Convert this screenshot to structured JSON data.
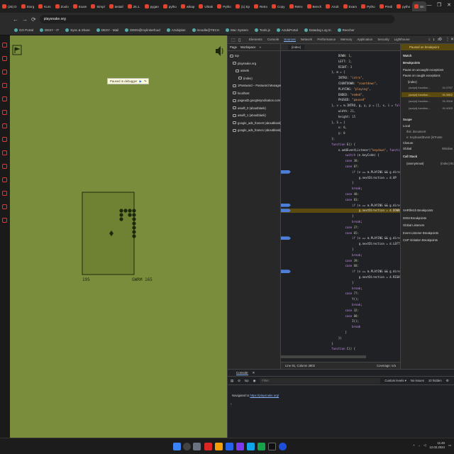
{
  "tabs": [
    {
      "label": "(26) D"
    },
    {
      "label": "Storg"
    },
    {
      "label": "Kurs"
    },
    {
      "label": "Zoolo"
    },
    {
      "label": "Exam"
    },
    {
      "label": "Simpl"
    },
    {
      "label": "testatl"
    },
    {
      "label": "26.1."
    },
    {
      "label": "pygan"
    },
    {
      "label": "pytho"
    },
    {
      "label": "wikap"
    },
    {
      "label": "Ultrak"
    },
    {
      "label": "Pytho"
    },
    {
      "label": "(1) Ep"
    },
    {
      "label": "Retro"
    },
    {
      "label": "Copy"
    },
    {
      "label": "Retro"
    },
    {
      "label": "Bench"
    },
    {
      "label": "Azub"
    },
    {
      "label": "Exam"
    },
    {
      "label": "Pytho"
    },
    {
      "label": "Predi"
    },
    {
      "label": "pytho"
    },
    {
      "label": "Sn",
      "active": true
    }
  ],
  "window_controls": [
    "—",
    "❐",
    "✕"
  ],
  "address": {
    "url": "playsnake.org",
    "nav": [
      "←",
      "→",
      "⟳"
    ]
  },
  "bookmarks": [
    "GO Portal",
    "DESY - IT",
    "Sync & Share",
    "DESY - Mail",
    "DEEN@mylinkerfood",
    "Azubiplan",
    "moodle@TECH",
    "Mac System",
    "Tools.js",
    "AzubiPortal",
    "Datadog Log In",
    "Reecher"
  ],
  "game": {
    "paused_banner": "Paused in debugger",
    "score_left": "195",
    "score_right": "GWRM 165",
    "colors": {
      "background": "#7a8d3c",
      "board": "#6f8133",
      "ink": "#1c2a0b"
    }
  },
  "devtools": {
    "tabs": [
      "Elements",
      "Console",
      "Sources",
      "Network",
      "Performance",
      "Memory",
      "Application",
      "Security",
      "Lighthouse"
    ],
    "active_tab": "Sources",
    "badges": {
      "errors": "1",
      "warnings": "1",
      "issues": "2"
    },
    "nav_tabs": [
      "Page",
      "Workspace",
      "»"
    ],
    "tree": [
      {
        "label": "top",
        "depth": 0
      },
      {
        "label": "playsnake.org",
        "depth": 1
      },
      {
        "label": "assets",
        "depth": 2
      },
      {
        "label": "(index)",
        "depth": 3
      },
      {
        "label": "1Password – Password Manager",
        "depth": 1
      },
      {
        "label": "localhost",
        "depth": 1
      },
      {
        "label": "pagead2.googlesyndication.com",
        "depth": 1
      },
      {
        "label": "aswift_0 (aboutblank)",
        "depth": 1
      },
      {
        "label": "aswift_1 (aboutblank)",
        "depth": 1
      },
      {
        "label": "google_ads_frame0 (aboutblank)",
        "depth": 1
      },
      {
        "label": "google_ads_frame1 (aboutblank)",
        "depth": 1
      }
    ],
    "open_file": "(index)",
    "code_lines": [
      {
        "t": "            DOWN: 1,"
      },
      {
        "t": "            LEFT: 2,"
      },
      {
        "t": "            RIGHT: 3"
      },
      {
        "t": "        }, m = {"
      },
      {
        "t": "            INTRO: \"intro\","
      },
      {
        "t": "            COUNTDOWN: \"countdown\","
      },
      {
        "t": "            PLAYING: \"playing\","
      },
      {
        "t": "            ENDED: \"ended\","
      },
      {
        "t": "            PAUSED: \"paused\""
      },
      {
        "t": "        }, v = m.INTRO, g, y, p = [], x, i = false, b, k,"
      },
      {
        "t": "            width: 21,"
      },
      {
        "t": "            height: 15"
      },
      {
        "t": "        }, S = {"
      },
      {
        "t": "            x: 0,"
      },
      {
        "t": "            y: 0"
      },
      {
        "t": "        };"
      },
      {
        "t": "        function E() {"
      },
      {
        "t": "            o.addEventListener(\"keydown\", function(e) {"
      },
      {
        "t": "                switch (e.keyCode) {"
      },
      {
        "t": "                case 38:"
      },
      {
        "t": "                case 87:"
      },
      {
        "t": "                    if (v == m.PLAYING && g.direction !=",
        "bp": true
      },
      {
        "t": "                        g.nextDirection = d.UP"
      },
      {
        "t": "                    }"
      },
      {
        "t": "                    break;"
      },
      {
        "t": "                case 40:"
      },
      {
        "t": "                case 83:"
      },
      {
        "t": "                    if (v == m.PLAYING && g.direction !=",
        "bp": true
      },
      {
        "t": "                        g.nextDirection = d.DOWN",
        "bp": true,
        "hl": true
      },
      {
        "t": "                    }"
      },
      {
        "t": "                    break;"
      },
      {
        "t": "                case 37:"
      },
      {
        "t": "                case 65:"
      },
      {
        "t": "                    if (v == m.PLAYING && g.direction !=",
        "bp": true
      },
      {
        "t": "                        g.nextDirection = d.LEFT"
      },
      {
        "t": "                    }"
      },
      {
        "t": "                    break;"
      },
      {
        "t": "                case 39:"
      },
      {
        "t": "                case 68:"
      },
      {
        "t": "                    if (v == m.PLAYING && g.direction !=",
        "bp": true
      },
      {
        "t": "                        g.nextDirection = d.RIGHT"
      },
      {
        "t": "                    }"
      },
      {
        "t": "                    break;"
      },
      {
        "t": "                case 77:"
      },
      {
        "t": "                    Y();"
      },
      {
        "t": "                    break;"
      },
      {
        "t": "                case 32:"
      },
      {
        "t": "                case 80:"
      },
      {
        "t": "                    I();"
      },
      {
        "t": "                    break"
      },
      {
        "t": "                }"
      },
      {
        "t": "            })"
      },
      {
        "t": "        }"
      },
      {
        "t": "        function C() {"
      }
    ],
    "status": {
      "position": "Line 91, Column 3802",
      "coverage": "Coverage: n/a"
    },
    "right": {
      "paused": "Paused on breakpoint",
      "watch": "Watch",
      "breakpoints": "Breakpoints",
      "pause_uncaught": "Pause on uncaught exceptions",
      "pause_caught": "Pause on caught exceptions",
      "bp_file": "(index)",
      "bp_items": [
        {
          "label": "(script) function...",
          "line": "91:2757"
        },
        {
          "label": "(script) function...",
          "line": "91:3802"
        },
        {
          "label": "(script) function...",
          "line": "91:3918"
        },
        {
          "label": "(script) function...",
          "line": "91:4003"
        }
      ],
      "scope": "Scope",
      "local": "Local",
      "this_label": "this: document",
      "e_label": "e: KeyboardEvent {isTruste",
      "closure": "Closure",
      "global": "Global",
      "global_val": "Window",
      "call_stack": "Call Stack",
      "anon": "(anonymous)",
      "anon_loc": "(index):91",
      "sections": [
        "XHR/fetch Breakpoints",
        "DOM Breakpoints",
        "Global Listeners",
        "Event Listener Breakpoints",
        "CSP Violation Breakpoints"
      ]
    },
    "console": {
      "tab": "Console",
      "top": "top",
      "filter_placeholder": "Filter",
      "levels": "Custom levels ▾",
      "issues": "No Issues",
      "hidden": "10 hidden",
      "nav_prefix": "Navigated to ",
      "nav_url": "https://playsnake.org/",
      "prompt": "›"
    }
  },
  "taskbar": {
    "time": "11:49",
    "date": "12.02.2024"
  }
}
